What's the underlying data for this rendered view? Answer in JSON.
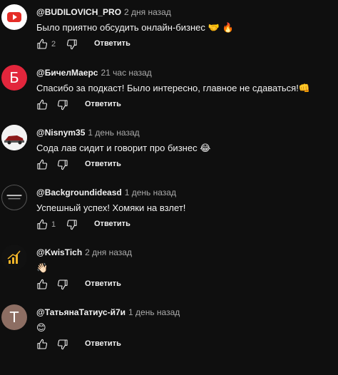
{
  "reply_label": "Ответить",
  "comments": [
    {
      "author": "@BUDILOVICH_PRO",
      "time": "2 дня назад",
      "text": "Было приятно обсудить онлайн-бизнес",
      "emoji": "🤝 🔥",
      "likes": "2",
      "avatar_letter": "",
      "avatar_color": "#ffffff"
    },
    {
      "author": "@БичелМаерс",
      "time": "21 час назад",
      "text": "Спасибо за подкаст! Было интересно, главное не сдаваться!",
      "emoji": "👊",
      "likes": "",
      "avatar_letter": "Б",
      "avatar_color": "#e2263c"
    },
    {
      "author": "@Nisnym35",
      "time": "1 день назад",
      "text": "Сода лав сидит и говорит про бизнес",
      "emoji": "😂",
      "likes": "",
      "avatar_letter": "",
      "avatar_color": "#e6e6e6"
    },
    {
      "author": "@Backgroundideasd",
      "time": "1 день назад",
      "text": "Успешный успех! Хомяки на взлет!",
      "emoji": "",
      "likes": "1",
      "avatar_letter": "",
      "avatar_color": "#111111"
    },
    {
      "author": "@KwisTich",
      "time": "2 дня назад",
      "text": "",
      "emoji": "👋🏻",
      "likes": "",
      "avatar_letter": "",
      "avatar_color": "#111111"
    },
    {
      "author": "@ТатьянаТатиус-й7и",
      "time": "1 день назад",
      "text": "",
      "emoji": "😊",
      "likes": "",
      "avatar_letter": "Т",
      "avatar_color": "#8d6e63"
    }
  ]
}
